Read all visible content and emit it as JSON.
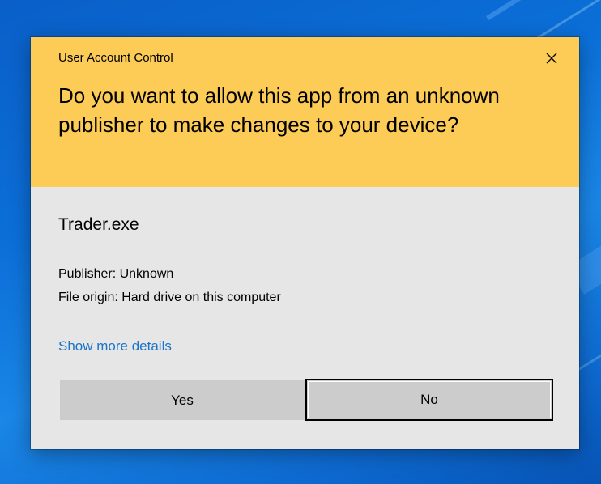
{
  "dialog": {
    "caption": "User Account Control",
    "close_icon": "close-icon",
    "question": "Do you want to allow this app from an unknown publisher to make changes to your device?",
    "app_name": "Trader.exe",
    "publisher": "Publisher: Unknown",
    "file_origin": "File origin: Hard drive on this computer",
    "details_link": "Show more details",
    "buttons": {
      "yes": "Yes",
      "no": "No"
    },
    "colors": {
      "header": "#fdcc56",
      "body": "#e6e6e6",
      "button": "#cccccc",
      "link": "#1a75c9"
    }
  },
  "desktop": {
    "wallpaper_color": "#0b6fd8"
  }
}
